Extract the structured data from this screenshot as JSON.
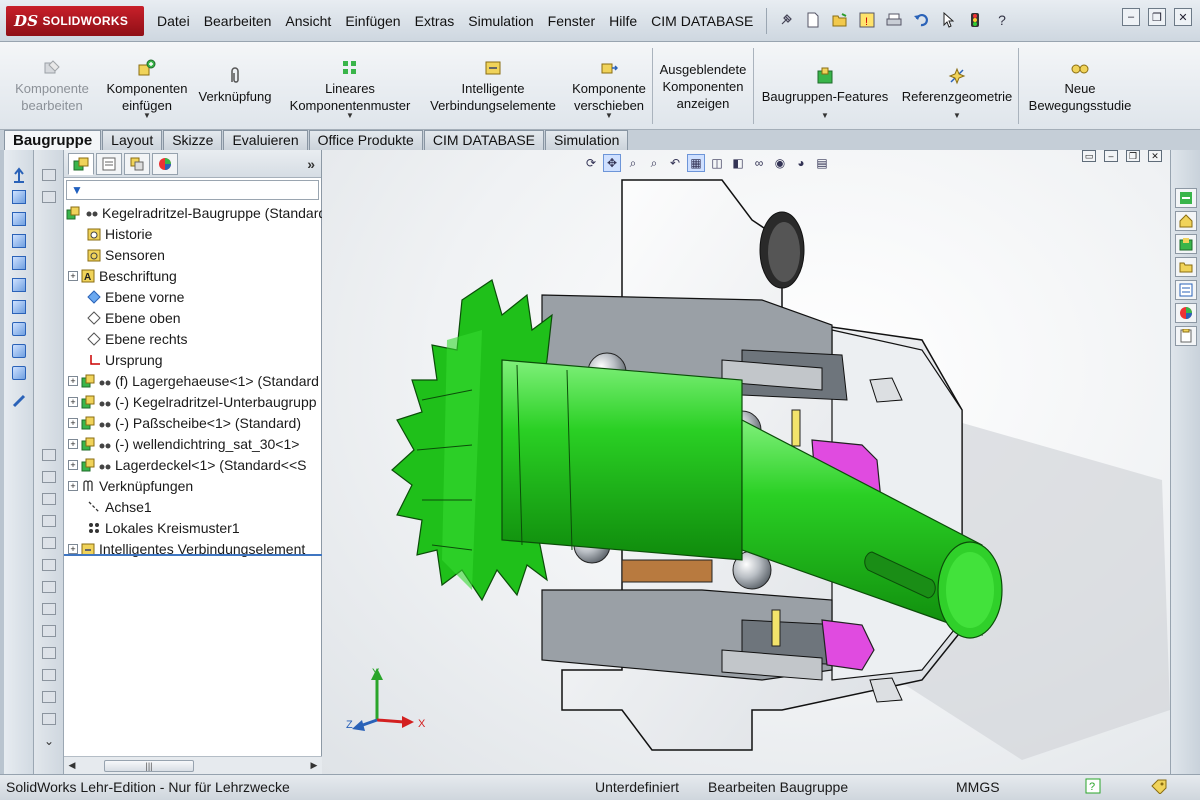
{
  "app": {
    "logo_text": "SOLIDWORKS",
    "logo_prefix": "DS"
  },
  "menu": [
    "Datei",
    "Bearbeiten",
    "Ansicht",
    "Einfügen",
    "Extras",
    "Simulation",
    "Fenster",
    "Hilfe",
    "CIM DATABASE"
  ],
  "toolbar_commands": {
    "komponente_bearbeiten": "Komponente\nbearbeiten",
    "komponenten_einfuegen": "Komponenten\neinfügen",
    "verknuepfung": "Verknüpfung",
    "lineares_muster": "Lineares\nKomponentenmuster",
    "intelligente_verbindung": "Intelligente\nVerbindungselemente",
    "komponente_verschieben": "Komponente\nverschieben",
    "ausgeblendete": "Ausgeblendete\nKomponenten\nanzeigen",
    "baugruppen_features": "Baugruppen-Features",
    "referenzgeometrie": "Referenzgeometrie",
    "neue_bewegungsstudie": "Neue\nBewegungsstudie"
  },
  "tabs": [
    "Baugruppe",
    "Layout",
    "Skizze",
    "Evaluieren",
    "Office Produkte",
    "CIM DATABASE",
    "Simulation"
  ],
  "tree": {
    "root": "Kegelradritzel-Baugruppe  (Standard",
    "items": [
      {
        "label": "Historie",
        "expandable": false
      },
      {
        "label": "Sensoren",
        "expandable": false
      },
      {
        "label": "Beschriftung",
        "expandable": true
      },
      {
        "label": "Ebene vorne",
        "expandable": false
      },
      {
        "label": "Ebene oben",
        "expandable": false
      },
      {
        "label": "Ebene rechts",
        "expandable": false
      },
      {
        "label": "Ursprung",
        "expandable": false
      },
      {
        "label": "(f) Lagergehaeuse<1> (Standard",
        "expandable": true
      },
      {
        "label": "(-) Kegelradritzel-Unterbaugrupp",
        "expandable": true
      },
      {
        "label": "(-) Paßscheibe<1> (Standard)",
        "expandable": true
      },
      {
        "label": "(-) wellendichtring_sat_30<1>",
        "expandable": true
      },
      {
        "label": "Lagerdeckel<1> (Standard<<S",
        "expandable": true
      },
      {
        "label": "Verknüpfungen",
        "expandable": true
      },
      {
        "label": "Achse1",
        "expandable": false
      },
      {
        "label": "Lokales Kreismuster1",
        "expandable": false
      },
      {
        "label": "Intelligentes Verbindungselement",
        "expandable": true
      }
    ]
  },
  "triad": {
    "x": "X",
    "y": "Y",
    "z": "Z"
  },
  "status": {
    "edition": "SolidWorks Lehr-Edition - Nur für Lehrzwecke",
    "definition": "Unterdefiniert",
    "mode": "Bearbeiten Baugruppe",
    "units": "MMGS"
  },
  "colors": {
    "gear_green": "#22c81e",
    "seal_magenta": "#e04be0",
    "logo_red": "#c8202a"
  }
}
